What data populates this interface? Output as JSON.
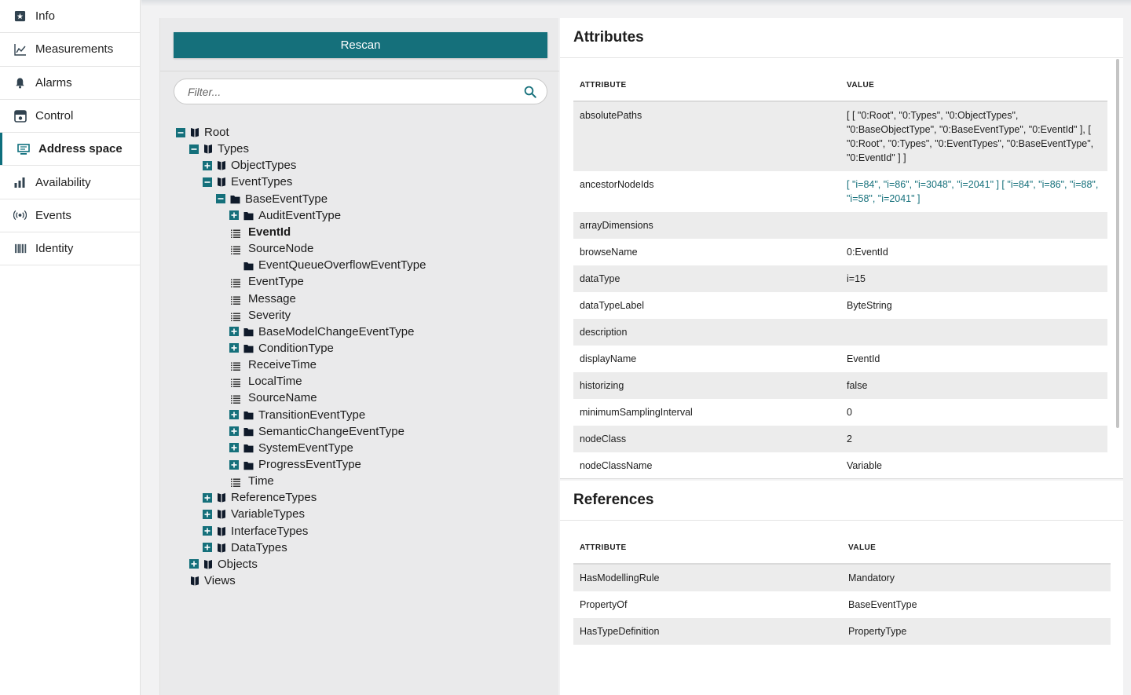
{
  "sidebar": {
    "items": [
      {
        "label": "Info",
        "icon": "info-icon"
      },
      {
        "label": "Measurements",
        "icon": "line-chart-icon"
      },
      {
        "label": "Alarms",
        "icon": "bell-icon"
      },
      {
        "label": "Control",
        "icon": "control-icon"
      },
      {
        "label": "Address space",
        "icon": "address-space-icon",
        "active": true
      },
      {
        "label": "Availability",
        "icon": "bar-chart-icon"
      },
      {
        "label": "Events",
        "icon": "broadcast-icon"
      },
      {
        "label": "Identity",
        "icon": "barcode-icon"
      }
    ]
  },
  "tree_panel": {
    "rescan_label": "Rescan",
    "filter_placeholder": "Filter...",
    "nodes": [
      {
        "label": "Root",
        "toggle": "minus",
        "icon": "book"
      },
      {
        "label": "Types",
        "toggle": "minus",
        "icon": "book"
      },
      {
        "label": "ObjectTypes",
        "toggle": "plus",
        "icon": "book"
      },
      {
        "label": "EventTypes",
        "toggle": "minus",
        "icon": "book"
      },
      {
        "label": "BaseEventType",
        "toggle": "minus",
        "icon": "folder"
      },
      {
        "label": "AuditEventType",
        "toggle": "plus",
        "icon": "folder"
      },
      {
        "label": "EventId",
        "icon": "list",
        "selected": true
      },
      {
        "label": "SourceNode",
        "icon": "list"
      },
      {
        "label": "EventQueueOverflowEventType",
        "icon": "folder"
      },
      {
        "label": "EventType",
        "icon": "list"
      },
      {
        "label": "Message",
        "icon": "list"
      },
      {
        "label": "Severity",
        "icon": "list"
      },
      {
        "label": "BaseModelChangeEventType",
        "toggle": "plus",
        "icon": "folder"
      },
      {
        "label": "ConditionType",
        "toggle": "plus",
        "icon": "folder"
      },
      {
        "label": "ReceiveTime",
        "icon": "list"
      },
      {
        "label": "LocalTime",
        "icon": "list"
      },
      {
        "label": "SourceName",
        "icon": "list"
      },
      {
        "label": "TransitionEventType",
        "toggle": "plus",
        "icon": "folder"
      },
      {
        "label": "SemanticChangeEventType",
        "toggle": "plus",
        "icon": "folder"
      },
      {
        "label": "SystemEventType",
        "toggle": "plus",
        "icon": "folder"
      },
      {
        "label": "ProgressEventType",
        "toggle": "plus",
        "icon": "folder"
      },
      {
        "label": "Time",
        "icon": "list"
      },
      {
        "label": "ReferenceTypes",
        "toggle": "plus",
        "icon": "book"
      },
      {
        "label": "VariableTypes",
        "toggle": "plus",
        "icon": "book"
      },
      {
        "label": "InterfaceTypes",
        "toggle": "plus",
        "icon": "book"
      },
      {
        "label": "DataTypes",
        "toggle": "plus",
        "icon": "book"
      },
      {
        "label": "Objects",
        "toggle": "plus",
        "icon": "book"
      },
      {
        "label": "Views",
        "icon": "book"
      }
    ]
  },
  "attributes": {
    "title": "Attributes",
    "col_attribute": "ATTRIBUTE",
    "col_value": "VALUE",
    "rows": [
      {
        "name": "absolutePaths",
        "value": "[ [ \"0:Root\", \"0:Types\", \"0:ObjectTypes\", \"0:BaseObjectType\", \"0:BaseEventType\", \"0:EventId\" ], [ \"0:Root\", \"0:Types\", \"0:EventTypes\", \"0:BaseEventType\", \"0:EventId\" ] ]"
      },
      {
        "name": "ancestorNodeIds",
        "value": "[ \"i=84\", \"i=86\", \"i=3048\", \"i=2041\" ] [ \"i=84\", \"i=86\", \"i=88\", \"i=58\", \"i=2041\" ]",
        "link": true
      },
      {
        "name": "arrayDimensions",
        "value": ""
      },
      {
        "name": "browseName",
        "value": "0:EventId"
      },
      {
        "name": "dataType",
        "value": "i=15"
      },
      {
        "name": "dataTypeLabel",
        "value": "ByteString"
      },
      {
        "name": "description",
        "value": ""
      },
      {
        "name": "displayName",
        "value": "EventId"
      },
      {
        "name": "historizing",
        "value": "false"
      },
      {
        "name": "minimumSamplingInterval",
        "value": "0"
      },
      {
        "name": "nodeClass",
        "value": "2"
      },
      {
        "name": "nodeClassName",
        "value": "Variable"
      }
    ]
  },
  "references": {
    "title": "References",
    "col_attribute": "ATTRIBUTE",
    "col_value": "VALUE",
    "rows": [
      {
        "name": "HasModellingRule",
        "value": "Mandatory"
      },
      {
        "name": "PropertyOf",
        "value": "BaseEventType"
      },
      {
        "name": "HasTypeDefinition",
        "value": "PropertyType"
      }
    ]
  },
  "colors": {
    "accent": "#15707b",
    "row_alt": "#ececec"
  }
}
